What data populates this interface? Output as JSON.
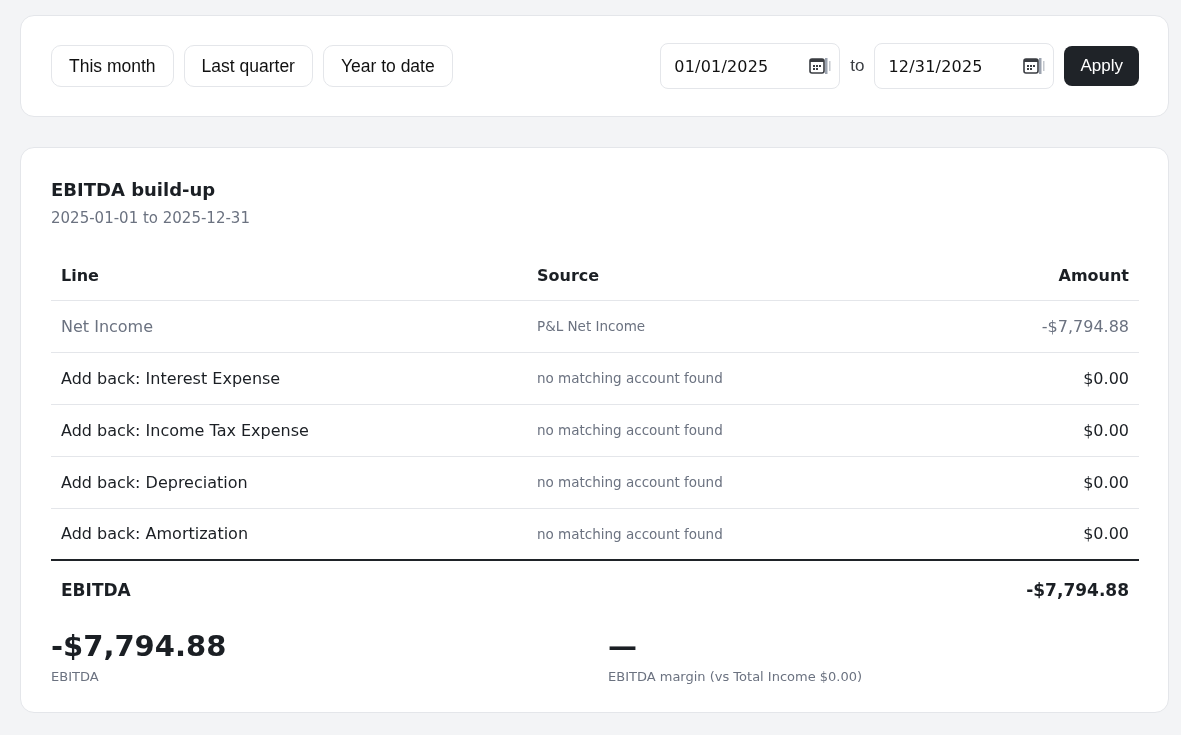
{
  "filters": {
    "presets": [
      {
        "label": "This month"
      },
      {
        "label": "Last quarter"
      },
      {
        "label": "Year to date"
      }
    ],
    "date_range": {
      "start": "01/01/2025",
      "separator": "to",
      "end": "12/31/2025",
      "apply": "Apply"
    }
  },
  "report": {
    "title": "EBITDA build-up",
    "period": "2025-01-01 to 2025-12-31",
    "table": {
      "columns": [
        "Line",
        "Source",
        "Amount"
      ],
      "rows": [
        {
          "line": "Net Income",
          "source": "P&L Net Income",
          "amount": "-$7,794.88",
          "muted": true
        },
        {
          "line": "Add back: Interest Expense",
          "source": "no matching account found",
          "amount": "$0.00",
          "muted": false
        },
        {
          "line": "Add back: Income Tax Expense",
          "source": "no matching account found",
          "amount": "$0.00",
          "muted": false
        },
        {
          "line": "Add back: Depreciation",
          "source": "no matching account found",
          "amount": "$0.00",
          "muted": false
        },
        {
          "line": "Add back: Amortization",
          "source": "no matching account found",
          "amount": "$0.00",
          "muted": false
        }
      ],
      "total": {
        "line": "EBITDA",
        "amount": "-$7,794.88"
      }
    },
    "summary": [
      {
        "value": "-$7,794.88",
        "label": "EBITDA"
      },
      {
        "value": "—",
        "label": "EBITDA margin (vs Total Income $0.00)"
      }
    ]
  }
}
